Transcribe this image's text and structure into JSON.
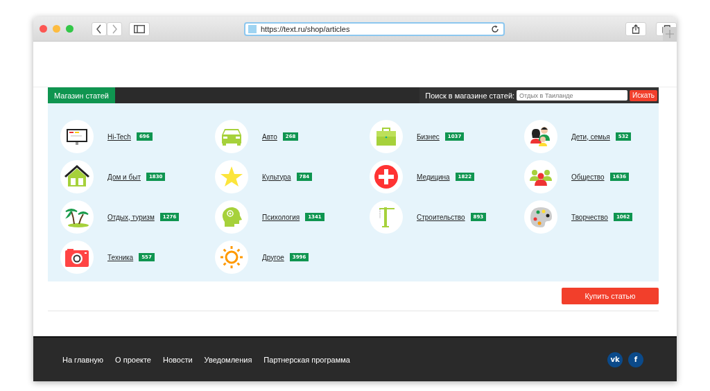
{
  "browser": {
    "url": "https://text.ru/shop/articles"
  },
  "shop_bar": {
    "tab": "Магазин статей",
    "search_label": "Поиск в магазине статей:",
    "search_placeholder": "Отдых в Таиланде",
    "search_button": "Искать"
  },
  "categories": [
    {
      "name": "Hi-Tech",
      "count": "696",
      "kind": "monitor"
    },
    {
      "name": "Авто",
      "count": "268",
      "kind": "car"
    },
    {
      "name": "Бизнес",
      "count": "1037",
      "kind": "briefcase"
    },
    {
      "name": "Дети, семья",
      "count": "532",
      "kind": "family"
    },
    {
      "name": "Дом и быт",
      "count": "1830",
      "kind": "house"
    },
    {
      "name": "Культура",
      "count": "784",
      "kind": "star"
    },
    {
      "name": "Медицина",
      "count": "1822",
      "kind": "cross"
    },
    {
      "name": "Общество",
      "count": "1636",
      "kind": "people"
    },
    {
      "name": "Отдых, туризм",
      "count": "1276",
      "kind": "palm"
    },
    {
      "name": "Психология",
      "count": "1341",
      "kind": "head"
    },
    {
      "name": "Строительство",
      "count": "893",
      "kind": "crane"
    },
    {
      "name": "Творчество",
      "count": "1062",
      "kind": "palette"
    },
    {
      "name": "Техника",
      "count": "557",
      "kind": "camera"
    },
    {
      "name": "Другое",
      "count": "3996",
      "kind": "sun"
    }
  ],
  "buy_button": "Купить статью",
  "footer": {
    "links": [
      "На главную",
      "О проекте",
      "Новости",
      "Уведомления",
      "Партнерская программа"
    ],
    "social": [
      "vk",
      "f"
    ]
  }
}
